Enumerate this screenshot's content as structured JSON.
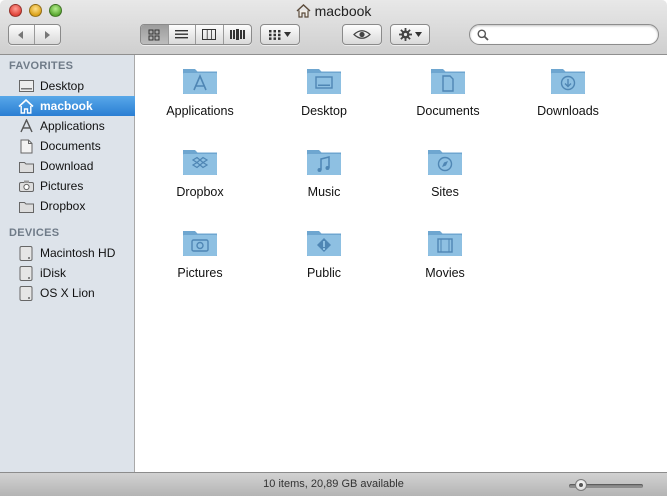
{
  "window": {
    "title": "macbook",
    "title_icon": "home-icon"
  },
  "toolbar": {
    "nav": [
      {
        "name": "back-button",
        "icon": "chevron-left-icon"
      },
      {
        "name": "forward-button",
        "icon": "chevron-right-icon"
      }
    ],
    "views": [
      {
        "name": "icon-view-button",
        "icon": "grid-icon",
        "active": true
      },
      {
        "name": "list-view-button",
        "icon": "list-icon",
        "active": false
      },
      {
        "name": "column-view-button",
        "icon": "columns-icon",
        "active": false
      },
      {
        "name": "coverflow-view-button",
        "icon": "coverflow-icon",
        "active": false
      }
    ],
    "arrange_icon": "arrange-grid-icon",
    "quicklook_icon": "eye-icon",
    "action_icon": "gear-icon",
    "search": {
      "value": "",
      "placeholder": "",
      "icon": "search-icon"
    }
  },
  "sidebar": {
    "favorites_title": "FAVORITES",
    "favorites": [
      {
        "label": "Desktop",
        "icon": "desktop-icon",
        "selected": false
      },
      {
        "label": "macbook",
        "icon": "home-icon",
        "selected": true
      },
      {
        "label": "Applications",
        "icon": "applications-icon",
        "selected": false
      },
      {
        "label": "Documents",
        "icon": "documents-icon",
        "selected": false
      },
      {
        "label": "Download",
        "icon": "download-icon",
        "selected": false
      },
      {
        "label": "Pictures",
        "icon": "camera-icon",
        "selected": false
      },
      {
        "label": "Dropbox",
        "icon": "folder-icon",
        "selected": false
      }
    ],
    "devices_title": "DEVICES",
    "devices": [
      {
        "label": "Macintosh HD",
        "icon": "hard-drive-icon"
      },
      {
        "label": "iDisk",
        "icon": "idisk-icon"
      },
      {
        "label": "OS X Lion",
        "icon": "disk-icon"
      }
    ]
  },
  "content": {
    "items": [
      {
        "label": "Applications",
        "glyph": "applications-glyph"
      },
      {
        "label": "Desktop",
        "glyph": "desktop-glyph"
      },
      {
        "label": "Documents",
        "glyph": "document-glyph"
      },
      {
        "label": "Downloads",
        "glyph": "download-glyph"
      },
      {
        "label": "Dropbox",
        "glyph": "dropbox-glyph"
      },
      {
        "label": "Music",
        "glyph": "music-glyph"
      },
      {
        "label": "Sites",
        "glyph": "compass-glyph"
      },
      {
        "label": "Pictures",
        "glyph": "camera-glyph"
      },
      {
        "label": "Public",
        "glyph": "public-glyph"
      },
      {
        "label": "Movies",
        "glyph": "film-glyph"
      }
    ]
  },
  "statusbar": {
    "text": "10 items, 20,89 GB available",
    "icon_size_fraction": 0.1
  },
  "colors": {
    "selection": "#2a7ed3",
    "sidebar_bg": "#dde3ea",
    "folder_blue": "#8ec0e2"
  }
}
